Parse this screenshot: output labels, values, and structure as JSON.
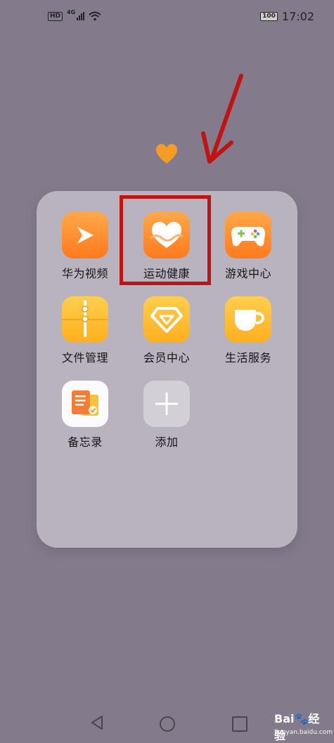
{
  "status_bar": {
    "hd": "HD",
    "network": "4G",
    "battery": "100",
    "time": "17:02"
  },
  "folder": {
    "apps": [
      {
        "label": "华为视频",
        "icon": "huawei-video-icon"
      },
      {
        "label": "运动健康",
        "icon": "health-heart-icon"
      },
      {
        "label": "游戏中心",
        "icon": "game-controller-icon"
      },
      {
        "label": "文件管理",
        "icon": "folder-icon"
      },
      {
        "label": "会员中心",
        "icon": "member-diamond-icon"
      },
      {
        "label": "生活服务",
        "icon": "coffee-cup-icon"
      },
      {
        "label": "备忘录",
        "icon": "notepad-icon"
      },
      {
        "label": "添加",
        "icon": "plus-icon"
      }
    ]
  },
  "watermark": {
    "brand": "Bai",
    "brand_cn": "经验",
    "url": "jingyan.baidu.com"
  },
  "colors": {
    "background": "#837b8c",
    "highlight": "#c21313",
    "accent_orange": "#ff7a1d"
  }
}
